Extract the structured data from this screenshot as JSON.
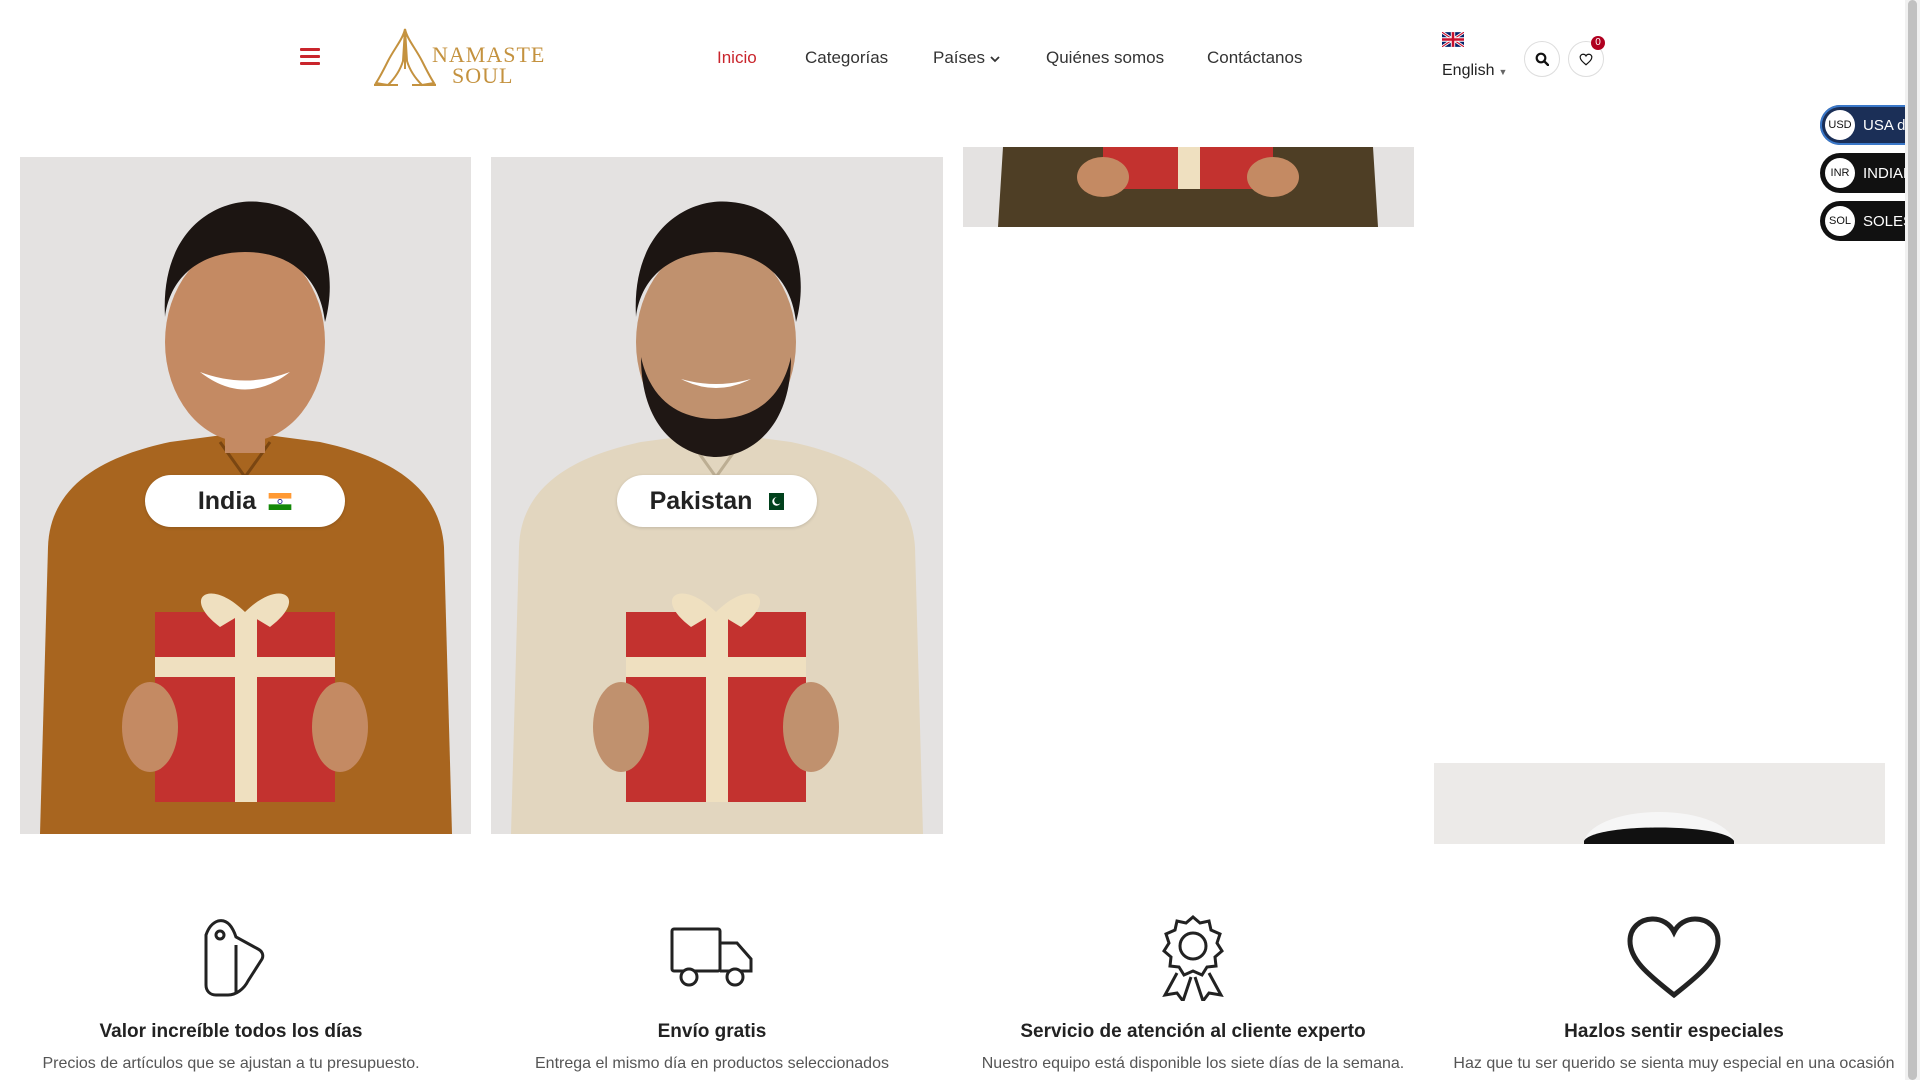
{
  "header": {
    "brand_line1": "NAMASTE",
    "brand_line2": "SOUL",
    "language": "English",
    "wishlist_count": "0"
  },
  "nav": {
    "items": [
      {
        "label": "Inicio",
        "active": true
      },
      {
        "label": "Categorías"
      },
      {
        "label": "Países",
        "dropdown": true
      },
      {
        "label": "Quiénes somos"
      },
      {
        "label": "Contáctanos"
      }
    ]
  },
  "currencies": [
    {
      "code": "USD",
      "name": "USA dollar",
      "active": true
    },
    {
      "code": "INR",
      "name": "INDIAN RUPEE"
    },
    {
      "code": "SOL",
      "name": "SOLES"
    }
  ],
  "countries": [
    {
      "name": "India",
      "flag": "india-flag",
      "shirt_color": "#a8651f"
    },
    {
      "name": "Pakistan",
      "flag": "pakistan-flag",
      "shirt_color": "#e2d6bf"
    }
  ],
  "features": [
    {
      "icon": "price-tag-icon",
      "title": "Valor increíble todos los días",
      "text": "Precios de artículos que se ajustan a tu presupuesto."
    },
    {
      "icon": "truck-icon",
      "title": "Envío gratis",
      "text": "Entrega el mismo día en productos seleccionados"
    },
    {
      "icon": "award-ribbon-icon",
      "title": "Servicio de atención al cliente experto",
      "text": "Nuestro equipo está disponible los siete días de la semana."
    },
    {
      "icon": "heart-icon",
      "title": "Hazlos sentir especiales",
      "text": "Haz que tu ser querido se sienta muy especial en una ocasión"
    }
  ],
  "colors": {
    "accent": "#c9252c",
    "gold": "#c4923f",
    "currency_bg": "#111111"
  }
}
